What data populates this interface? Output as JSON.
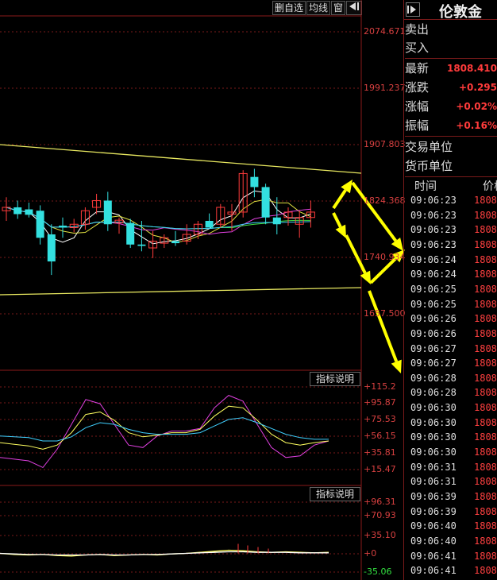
{
  "toolbar": {
    "watchlist_label": "删自选",
    "ma_label": "均线",
    "window_label": "窗",
    "expand_icon": "expand-right-icon"
  },
  "price_axis": [
    "2074.671",
    "1991.237",
    "1907.803",
    "1824.368",
    "1740.934",
    "1657.500"
  ],
  "indicator1": {
    "button": "指标说明",
    "axis": [
      "+115.2",
      "+95.87",
      "+75.53",
      "+56.15",
      "+35.81",
      "+15.47"
    ]
  },
  "indicator2": {
    "button": "指标说明",
    "axis": [
      "+96.31",
      "+70.93",
      "+35.10",
      "+0",
      "-35.06"
    ]
  },
  "right_panel": {
    "title": "伦敦金",
    "sell_label": "卖出",
    "buy_label": "买入",
    "latest_label": "最新",
    "latest_value": "1808.410",
    "change_label": "涨跌",
    "change_value": "+0.295",
    "change_pct_label": "涨幅",
    "change_pct_value": "+0.02%",
    "amplitude_label": "振幅",
    "amplitude_value": "+0.16%",
    "trade_unit_label": "交易单位",
    "currency_unit_label": "货币单位",
    "col_time": "时间",
    "col_price": "价格"
  },
  "ticks": [
    {
      "time": "09:06:23",
      "price": "1808."
    },
    {
      "time": "09:06:23",
      "price": "1808."
    },
    {
      "time": "09:06:23",
      "price": "1808."
    },
    {
      "time": "09:06:23",
      "price": "1808."
    },
    {
      "time": "09:06:24",
      "price": "1808."
    },
    {
      "time": "09:06:24",
      "price": "1808."
    },
    {
      "time": "09:06:25",
      "price": "1808."
    },
    {
      "time": "09:06:25",
      "price": "1808."
    },
    {
      "time": "09:06:26",
      "price": "1808."
    },
    {
      "time": "09:06:26",
      "price": "1808."
    },
    {
      "time": "09:06:27",
      "price": "1808."
    },
    {
      "time": "09:06:27",
      "price": "1808."
    },
    {
      "time": "09:06:28",
      "price": "1808."
    },
    {
      "time": "09:06:28",
      "price": "1808."
    },
    {
      "time": "09:06:30",
      "price": "1808."
    },
    {
      "time": "09:06:30",
      "price": "1808."
    },
    {
      "time": "09:06:30",
      "price": "1808."
    },
    {
      "time": "09:06:30",
      "price": "1808."
    },
    {
      "time": "09:06:31",
      "price": "1808."
    },
    {
      "time": "09:06:31",
      "price": "1808."
    },
    {
      "time": "09:06:39",
      "price": "1808."
    },
    {
      "time": "09:06:39",
      "price": "1808."
    },
    {
      "time": "09:06:40",
      "price": "1808."
    },
    {
      "time": "09:06:40",
      "price": "1808."
    },
    {
      "time": "09:06:41",
      "price": "1808."
    },
    {
      "time": "09:06:41",
      "price": "1808."
    }
  ],
  "colors": {
    "up": "#ff3b3b",
    "down": "#33e0e0",
    "trendline": "#e8e860",
    "arrow": "#ffff00",
    "grid": "#7a1a1a"
  },
  "candles": [
    {
      "o": 1810,
      "h": 1830,
      "l": 1795,
      "c": 1815
    },
    {
      "o": 1815,
      "h": 1825,
      "l": 1798,
      "c": 1805
    },
    {
      "o": 1812,
      "h": 1822,
      "l": 1800,
      "c": 1804
    },
    {
      "o": 1810,
      "h": 1818,
      "l": 1760,
      "c": 1770
    },
    {
      "o": 1775,
      "h": 1790,
      "l": 1715,
      "c": 1735
    },
    {
      "o": 1788,
      "h": 1800,
      "l": 1770,
      "c": 1785
    },
    {
      "o": 1785,
      "h": 1798,
      "l": 1778,
      "c": 1790
    },
    {
      "o": 1790,
      "h": 1815,
      "l": 1782,
      "c": 1810
    },
    {
      "o": 1815,
      "h": 1835,
      "l": 1805,
      "c": 1825
    },
    {
      "o": 1825,
      "h": 1838,
      "l": 1780,
      "c": 1790
    },
    {
      "o": 1792,
      "h": 1800,
      "l": 1776,
      "c": 1796
    },
    {
      "o": 1792,
      "h": 1798,
      "l": 1755,
      "c": 1760
    },
    {
      "o": 1760,
      "h": 1795,
      "l": 1750,
      "c": 1758
    },
    {
      "o": 1755,
      "h": 1780,
      "l": 1740,
      "c": 1765
    },
    {
      "o": 1762,
      "h": 1775,
      "l": 1755,
      "c": 1770
    },
    {
      "o": 1765,
      "h": 1780,
      "l": 1758,
      "c": 1762
    },
    {
      "o": 1765,
      "h": 1790,
      "l": 1760,
      "c": 1775
    },
    {
      "o": 1775,
      "h": 1795,
      "l": 1768,
      "c": 1790
    },
    {
      "o": 1795,
      "h": 1806,
      "l": 1785,
      "c": 1785
    },
    {
      "o": 1790,
      "h": 1820,
      "l": 1785,
      "c": 1815
    },
    {
      "o": 1805,
      "h": 1820,
      "l": 1780,
      "c": 1808
    },
    {
      "o": 1808,
      "h": 1870,
      "l": 1800,
      "c": 1865
    },
    {
      "o": 1860,
      "h": 1872,
      "l": 1830,
      "c": 1845
    },
    {
      "o": 1845,
      "h": 1850,
      "l": 1790,
      "c": 1800
    },
    {
      "o": 1800,
      "h": 1830,
      "l": 1775,
      "c": 1790
    },
    {
      "o": 1800,
      "h": 1815,
      "l": 1788,
      "c": 1808
    },
    {
      "o": 1790,
      "h": 1810,
      "l": 1770,
      "c": 1800
    },
    {
      "o": 1800,
      "h": 1825,
      "l": 1785,
      "c": 1808
    }
  ]
}
